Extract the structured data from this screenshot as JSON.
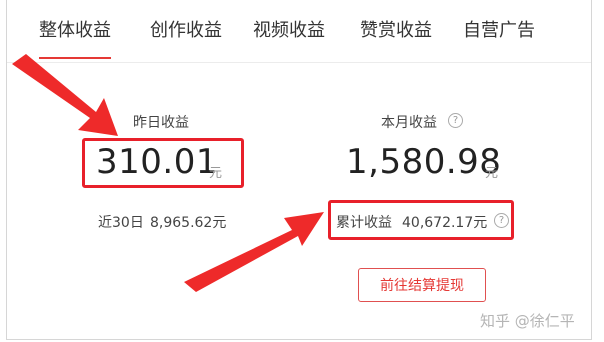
{
  "tabs": [
    {
      "label": "整体收益",
      "active": true
    },
    {
      "label": "创作收益",
      "active": false
    },
    {
      "label": "视频收益",
      "active": false
    },
    {
      "label": "赞赏收益",
      "active": false
    },
    {
      "label": "自营广告",
      "active": false
    }
  ],
  "yesterday": {
    "label": "昨日收益",
    "value": "310.01",
    "unit": "元",
    "last30_label": "近30日",
    "last30_value": "8,965.62元"
  },
  "month": {
    "label": "本月收益",
    "value": "1,580.98",
    "unit": "元",
    "cumulative_label": "累计收益",
    "cumulative_value": "40,672.17元"
  },
  "withdraw_button": "前往结算提现",
  "watermark": "知乎 @徐仁平",
  "colors": {
    "accent": "#e53935",
    "annotation": "#e8202a"
  }
}
